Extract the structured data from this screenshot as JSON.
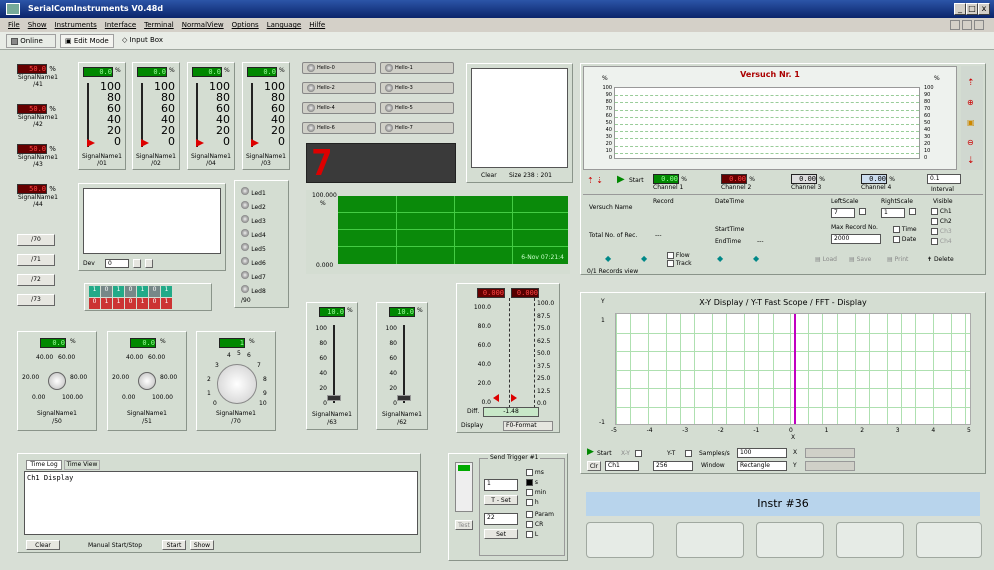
{
  "app": {
    "title": "SerialComInstruments  V0.48d"
  },
  "menu": [
    "File",
    "Show",
    "Instruments",
    "Interface",
    "Terminal",
    "NormalView",
    "Options",
    "Language",
    "Hilfe"
  ],
  "modebar": {
    "online": "Online",
    "edit": "Edit Mode",
    "input": "Input Box"
  },
  "signals_left": [
    {
      "val": "50.0",
      "unit": "%",
      "name": "SignalName1",
      "id": "/41"
    },
    {
      "val": "50.0",
      "unit": "%",
      "name": "SignalName1",
      "id": "/42"
    },
    {
      "val": "50.0",
      "unit": "%",
      "name": "SignalName1",
      "id": "/43"
    },
    {
      "val": "50.0",
      "unit": "%",
      "name": "SignalName1",
      "id": "/44"
    }
  ],
  "bargraphs": [
    {
      "val": "0.0",
      "unit": "%",
      "name": "SignalName1",
      "id": "/01",
      "scale": [
        "100",
        "80",
        "60",
        "40",
        "20",
        "0"
      ]
    },
    {
      "val": "0.0",
      "unit": "%",
      "name": "SignalName1",
      "id": "/02",
      "scale": [
        "100",
        "80",
        "60",
        "40",
        "20",
        "0"
      ]
    },
    {
      "val": "0.0",
      "unit": "%",
      "name": "SignalName1",
      "id": "/04",
      "scale": [
        "100",
        "80",
        "60",
        "40",
        "20",
        "0"
      ]
    },
    {
      "val": "0.0",
      "unit": "%",
      "name": "SignalName1",
      "id": "/03",
      "scale": [
        "100",
        "80",
        "60",
        "40",
        "20",
        "0"
      ]
    }
  ],
  "switches": [
    "Hello-0",
    "Hello-1",
    "Hello-2",
    "Hello-3",
    "Hello-4",
    "Hello-5",
    "Hello-6",
    "Hello-7"
  ],
  "seg_display": "7",
  "image_box": {
    "clear": "Clear",
    "size": "Size 238 : 201"
  },
  "big_box": {
    "dev": "Dev",
    "value": "0"
  },
  "leds": [
    "Led1",
    "Led2",
    "Led3",
    "Led4",
    "Led5",
    "Led6",
    "Led7",
    "Led8"
  ],
  "led_id": "/90",
  "buttons_left": [
    "/70",
    "/71",
    "/72",
    "/73"
  ],
  "bits": [
    "1",
    "0",
    "1",
    "0",
    "1",
    "0",
    "1",
    "0",
    "1",
    "1",
    "0",
    "1",
    "0",
    "1"
  ],
  "scope_green": {
    "ytop": "100.000",
    "yunit": "%",
    "ybot": "0.000",
    "date": "6-Nov 07:21:4"
  },
  "knobs": [
    {
      "val": "0.0",
      "unit": "%",
      "name": "SignalName1",
      "id": "/50",
      "t1": "40.00",
      "t2": "60.00",
      "t3": "20.00",
      "t4": "80.00",
      "t5": "0.00",
      "t6": "100.00"
    },
    {
      "val": "0.0",
      "unit": "%",
      "name": "SignalName1",
      "id": "/51",
      "t1": "40.00",
      "t2": "60.00",
      "t3": "20.00",
      "t4": "80.00",
      "t5": "0.00",
      "t6": "100.00"
    }
  ],
  "big_knob": {
    "val": "1",
    "unit": "%",
    "name": "SignalName1",
    "id": "/70",
    "ticks": [
      "4",
      "5",
      "6",
      "3",
      "7",
      "2",
      "8",
      "1",
      "9",
      "0",
      "10"
    ]
  },
  "sliders": [
    {
      "val": "10.0",
      "unit": "%",
      "name": "SignalName1",
      "id": "/63",
      "scale": [
        "100",
        "80",
        "60",
        "40",
        "20",
        "0"
      ]
    },
    {
      "val": "10.0",
      "unit": "%",
      "name": "SignalName1",
      "id": "/62",
      "scale": [
        "100",
        "80",
        "60",
        "40",
        "20",
        "0"
      ]
    }
  ],
  "diff": {
    "left_val": "0.000",
    "right_val": "0.000",
    "left_scale": [
      "100.0",
      "80.0",
      "60.0",
      "40.0",
      "20.0",
      "0.0"
    ],
    "right_scale": [
      "100.0",
      "87.5",
      "75.0",
      "62.5",
      "50.0",
      "37.5",
      "25.0",
      "12.5",
      "0.0"
    ],
    "diff_label": "Diff.",
    "diff_val": "-1.48",
    "display_label": "Display",
    "display_val": "F0-Format"
  },
  "time_log": {
    "tabs": [
      "Time Log",
      "Time View"
    ],
    "text": "Ch1 Display",
    "clear": "Clear",
    "manual": "Manual Start/Stop",
    "start": "Start",
    "show": "Show"
  },
  "send_trigger": {
    "title": "Send Trigger #1",
    "v1": "1",
    "tset": "T - Set",
    "v2": "22",
    "set": "Set",
    "units": [
      "ms",
      "s",
      "min",
      "h",
      "Param",
      "CR",
      "L"
    ],
    "test": "Test"
  },
  "chart1": {
    "title": "Versuch Nr. 1",
    "unit": "%",
    "yticks": [
      "100",
      "90",
      "80",
      "70",
      "60",
      "50",
      "40",
      "30",
      "20",
      "10",
      "0"
    ],
    "channels": [
      {
        "val": "0.00",
        "unit": "%",
        "name": "Channel 1"
      },
      {
        "val": "0.00",
        "unit": "%",
        "name": "Channel 2"
      },
      {
        "val": "0.00",
        "unit": "%",
        "name": "Channel 3"
      },
      {
        "val": "0.00",
        "unit": "%",
        "name": "Channel 4"
      }
    ],
    "start": "Start",
    "interval_val": "0.1",
    "interval": "Interval",
    "versuch_name": "Versuch Name",
    "total": "Total No. of Rec.",
    "total_val": "---",
    "record": "Record",
    "datetime": "DateTime",
    "starttime": "StartTime",
    "endtime": "EndTime",
    "st_val": "---",
    "et_val": "---",
    "leftscale": "LeftScale",
    "rightscale": "RightScale",
    "left_v": "7",
    "right_v": "1",
    "maxrec": "Max Record No.",
    "maxrec_v": "2000",
    "time": "Time",
    "date": "Date",
    "visible": "Visible",
    "chs": [
      "Ch1",
      "Ch2",
      "Ch3",
      "Ch4"
    ],
    "flow": "Flow",
    "track": "Track",
    "load": "Load",
    "save": "Save",
    "print": "Print",
    "delete": "Delete",
    "records": "0/1 Records view"
  },
  "chart2": {
    "title": "X-Y  Display   /   Y-T  Fast Scope  /  FFT - Display",
    "xticks": [
      "-5",
      "-4",
      "-3",
      "-2",
      "-1",
      "0",
      "1",
      "2",
      "3",
      "4",
      "5"
    ],
    "xlabel": "X",
    "ylabel": "Y",
    "ytop": "1",
    "ybot": "-1",
    "start": "Start",
    "xy": "X-Y",
    "yt": "Y-T",
    "samples_label": "Samples/s",
    "samples_val": "100",
    "clr": "Clr",
    "ch": "Ch1",
    "n": "256",
    "window": "Window",
    "window_val": "Rectangle",
    "x": "X",
    "y": "Y"
  },
  "instr": {
    "label": "Instr #36"
  },
  "colors": {
    "accent": "#0a246a",
    "scope_green": "#0a8a0a",
    "pink": "#c000c0"
  }
}
